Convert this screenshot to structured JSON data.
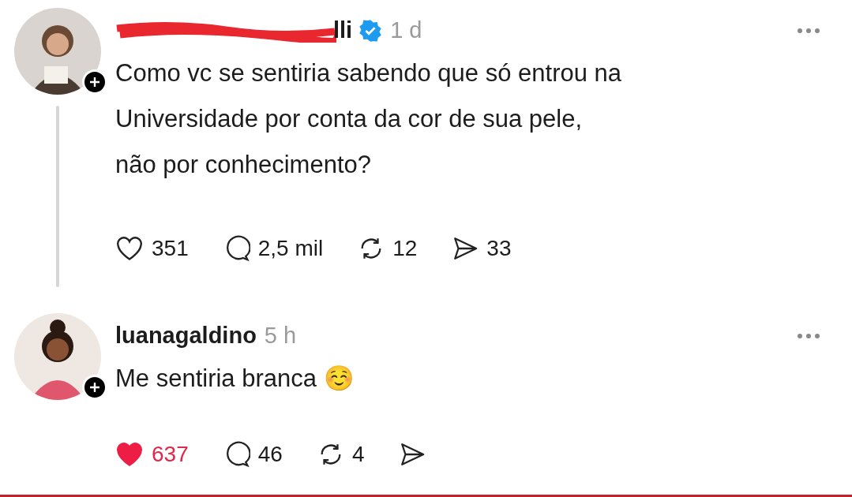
{
  "posts": [
    {
      "username": "lli",
      "username_redacted": true,
      "verified": true,
      "time": "1 d",
      "text_lines": [
        "Como vc se sentiria sabendo que só entrou na",
        "Universidade por conta da cor de sua pele,",
        "não por conhecimento?"
      ],
      "thread_line": true,
      "liked": false,
      "likes": "351",
      "replies": "2,5 mil",
      "reposts": "12",
      "shares": "33"
    },
    {
      "username": "luanagaldino",
      "username_redacted": false,
      "verified": false,
      "time": "5 h",
      "text_lines": [
        "Me sentiria branca ☺️"
      ],
      "thread_line": false,
      "liked": true,
      "likes": "637",
      "replies": "46",
      "reposts": "4"
    }
  ]
}
